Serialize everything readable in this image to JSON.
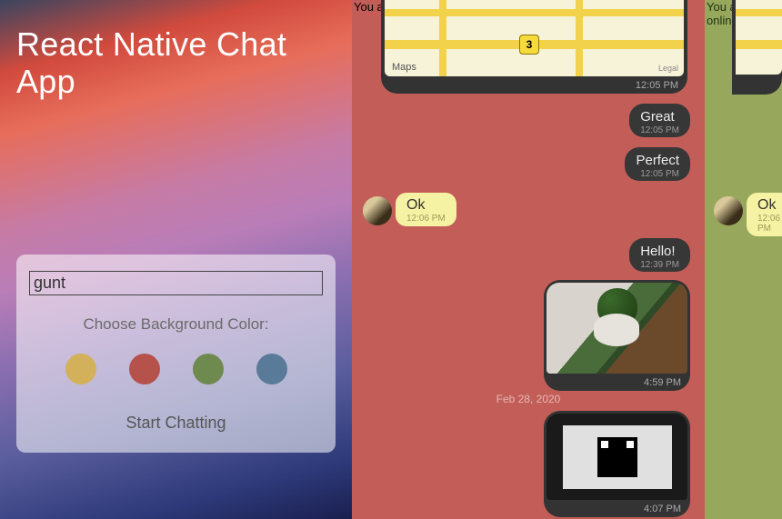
{
  "left": {
    "title": "React Native Chat App",
    "name_value": "gunt",
    "choose_label": "Choose Background Color:",
    "colors": [
      "#d2b15a",
      "#b6524c",
      "#6f8a4f",
      "#5a7a99"
    ],
    "start_label": "Start Chatting"
  },
  "mid": {
    "online": "You are online gunt!",
    "map_brand": " Maps",
    "map_legal": "Legal",
    "map_badge": "3",
    "map_time": "12:05 PM",
    "msgs": [
      {
        "text": "Great",
        "time": "12:05 PM"
      },
      {
        "text": "Perfect",
        "time": "12:05 PM"
      },
      {
        "text": "Ok",
        "time": "12:06 PM"
      },
      {
        "text": "Hello!",
        "time": "12:39 PM"
      }
    ],
    "plant_time": "4:59 PM",
    "date_sep": "Feb 28, 2020",
    "qr_time": "4:07 PM"
  },
  "right": {
    "online": "You are online gunt!",
    "ok_text": "Ok",
    "ok_time": "12:06 PM"
  }
}
